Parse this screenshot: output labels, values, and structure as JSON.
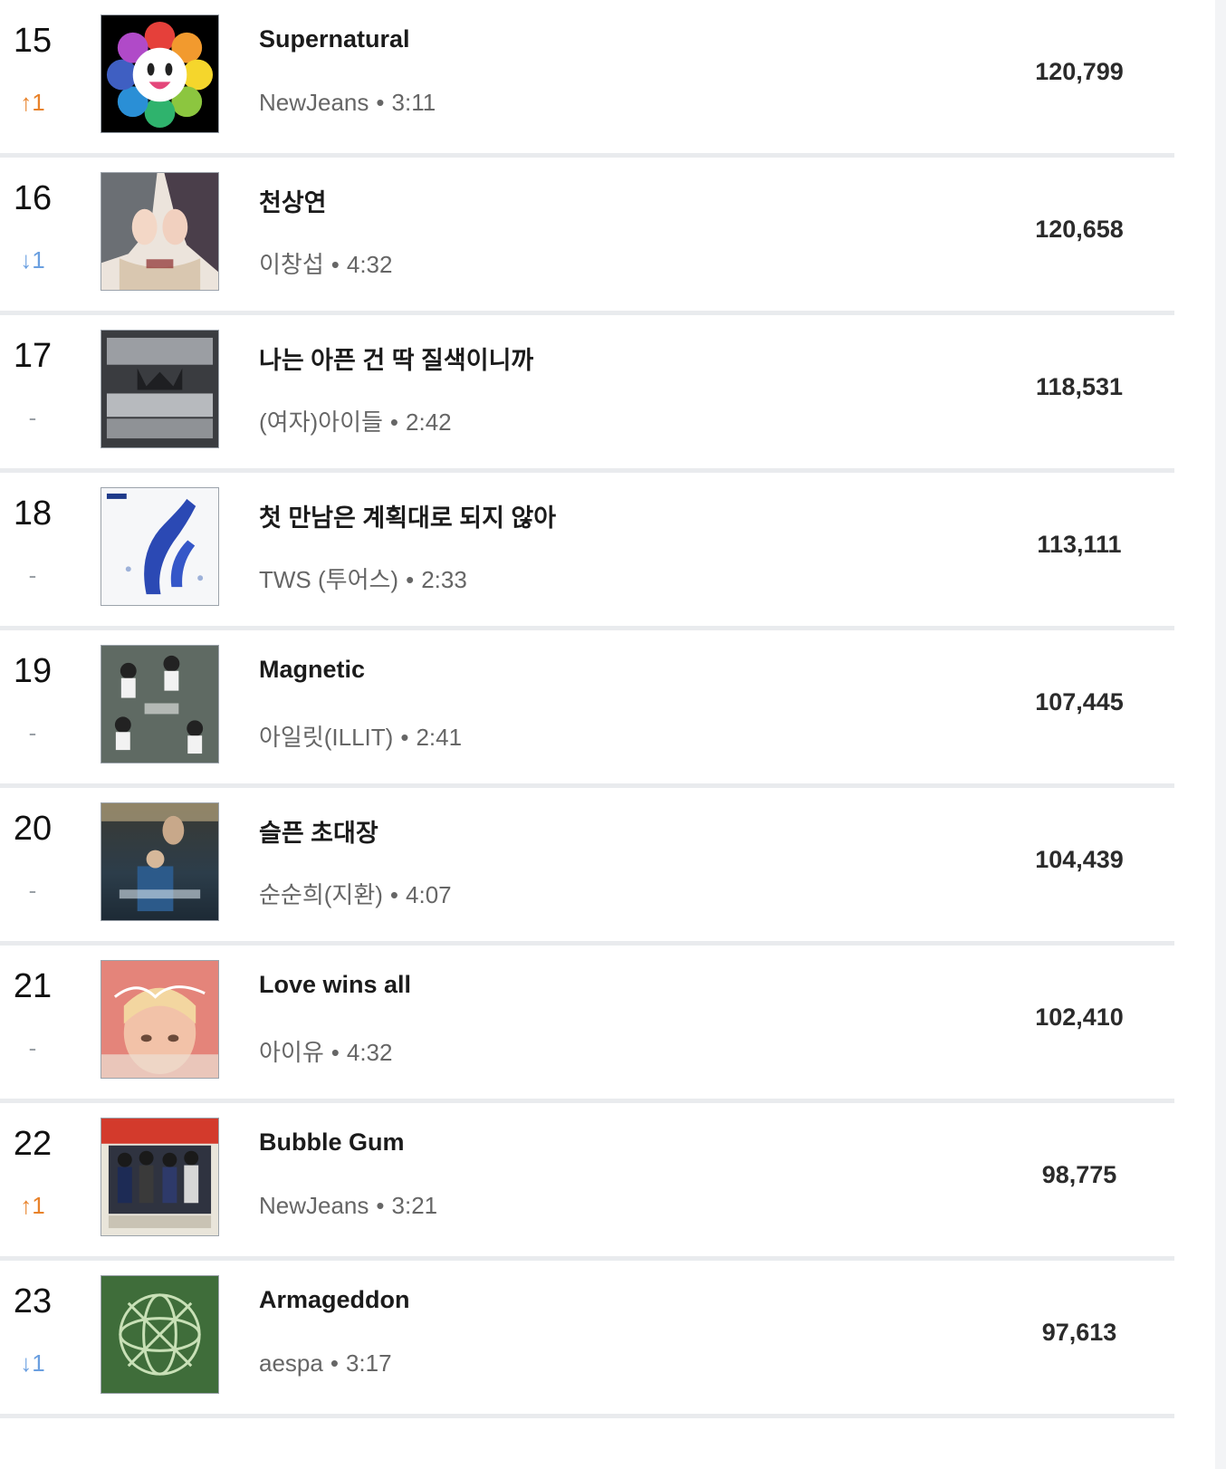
{
  "colors": {
    "up": "#e8822a",
    "down": "#6a9fe0",
    "same": "#9aa0a6",
    "divider": "#e9ebee"
  },
  "rows": [
    {
      "rank": "15",
      "change": "↑1",
      "change_dir": "up",
      "title": "Supernatural",
      "artist": "NewJeans",
      "duration": "3:11",
      "streams": "120,799",
      "art": "flower-art"
    },
    {
      "rank": "16",
      "change": "↓1",
      "change_dir": "down",
      "title": "천상연",
      "artist": "이창섭",
      "duration": "4:32",
      "streams": "120,658",
      "art": "illustration-art"
    },
    {
      "rank": "17",
      "change": "-",
      "change_dir": "same",
      "title": "나는 아픈 건 딱 질색이니까",
      "artist": "(여자)아이들",
      "duration": "2:42",
      "streams": "118,531",
      "art": "gidle-art"
    },
    {
      "rank": "18",
      "change": "-",
      "change_dir": "same",
      "title": "첫 만남은 계획대로 되지 않아",
      "artist": "TWS (투어스)",
      "duration": "2:33",
      "streams": "113,111",
      "art": "tws-art"
    },
    {
      "rank": "19",
      "change": "-",
      "change_dir": "same",
      "title": "Magnetic",
      "artist": "아일릿(ILLIT)",
      "duration": "2:41",
      "streams": "107,445",
      "art": "illit-art"
    },
    {
      "rank": "20",
      "change": "-",
      "change_dir": "same",
      "title": "슬픈 초대장",
      "artist": "순순희(지환)",
      "duration": "4:07",
      "streams": "104,439",
      "art": "photo-art"
    },
    {
      "rank": "21",
      "change": "-",
      "change_dir": "same",
      "title": "Love wins all",
      "artist": "아이유",
      "duration": "4:32",
      "streams": "102,410",
      "art": "winning-art"
    },
    {
      "rank": "22",
      "change": "↑1",
      "change_dir": "up",
      "title": "Bubble Gum",
      "artist": "NewJeans",
      "duration": "3:21",
      "streams": "98,775",
      "art": "newjeans-art"
    },
    {
      "rank": "23",
      "change": "↓1",
      "change_dir": "down",
      "title": "Armageddon",
      "artist": "aespa",
      "duration": "3:17",
      "streams": "97,613",
      "art": "aespa-art"
    }
  ]
}
